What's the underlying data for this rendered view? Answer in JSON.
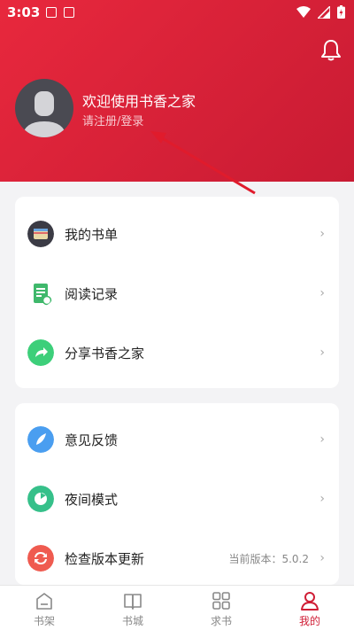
{
  "status_bar": {
    "time": "3:03"
  },
  "profile": {
    "welcome": "欢迎使用书香之家",
    "login_link": "请注册/登录"
  },
  "menu_group1": [
    {
      "label": "我的书单",
      "icon": "booklist-icon"
    },
    {
      "label": "阅读记录",
      "icon": "reading-record-icon"
    },
    {
      "label": "分享书香之家",
      "icon": "share-icon"
    }
  ],
  "menu_group2": [
    {
      "label": "意见反馈",
      "icon": "feedback-icon"
    },
    {
      "label": "夜间模式",
      "icon": "night-mode-icon"
    },
    {
      "label": "检查版本更新",
      "icon": "update-icon",
      "sub": "当前版本：5.0.2"
    }
  ],
  "tabs": [
    {
      "label": "书架",
      "icon": "bookshelf-icon"
    },
    {
      "label": "书城",
      "icon": "bookstore-icon"
    },
    {
      "label": "求书",
      "icon": "request-book-icon"
    },
    {
      "label": "我的",
      "icon": "profile-icon",
      "active": true
    }
  ],
  "colors": {
    "accent": "#d01e36",
    "header": "#d81f36",
    "background": "#f3f3f5"
  }
}
